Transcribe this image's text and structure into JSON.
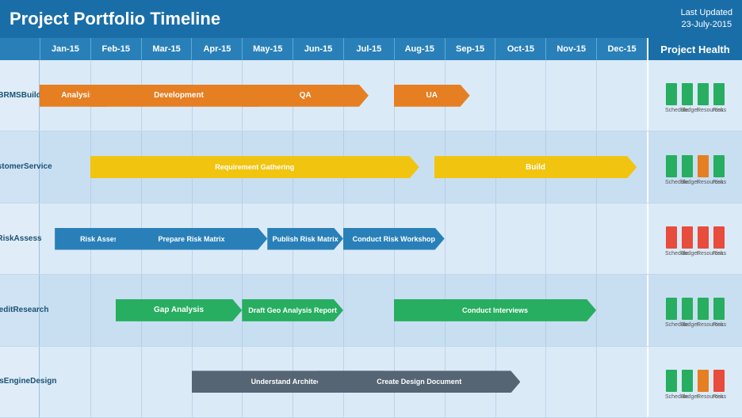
{
  "header": {
    "title": "Project Portfolio Timeline",
    "last_updated_label": "Last Updated",
    "last_updated_date": "23-July-2015"
  },
  "months": [
    "Jan-15",
    "Feb-15",
    "Mar-15",
    "Apr-15",
    "May-15",
    "Jun-15",
    "Jul-15",
    "Aug-15",
    "Sep-15",
    "Oct-15",
    "Nov-15",
    "Dec-15"
  ],
  "project_health_label": "Project Health",
  "projects": [
    {
      "label": "BRMS Build",
      "tasks": [
        {
          "label": "Analysis",
          "color": "#e67e22",
          "start": 0,
          "end": 1.5
        },
        {
          "label": "Development",
          "color": "#e67e22",
          "start": 1,
          "end": 4.5
        },
        {
          "label": "QA",
          "color": "#e67e22",
          "start": 4,
          "end": 6.5
        },
        {
          "label": "UA",
          "color": "#e67e22",
          "start": 7,
          "end": 8.5
        }
      ],
      "health": [
        {
          "color": "green",
          "height": 28
        },
        {
          "color": "green",
          "height": 28
        },
        {
          "color": "green",
          "height": 28
        },
        {
          "color": "green",
          "height": 28
        }
      ]
    },
    {
      "label": "Customer Service",
      "tasks": [
        {
          "label": "Requirement Gathering",
          "color": "#f1c40f",
          "start": 1,
          "end": 7.5
        },
        {
          "label": "Build",
          "color": "#f1c40f",
          "start": 7.8,
          "end": 11.8
        }
      ],
      "health": [
        {
          "color": "green",
          "height": 28
        },
        {
          "color": "green",
          "height": 28
        },
        {
          "color": "orange",
          "height": 28
        },
        {
          "color": "green",
          "height": 28
        }
      ]
    },
    {
      "label": "Risk Assess",
      "tasks": [
        {
          "label": "Risk Assessment Plan",
          "color": "#2980b9",
          "start": 0.3,
          "end": 2.8
        },
        {
          "label": "Prepare Risk Matrix",
          "color": "#2980b9",
          "start": 1.5,
          "end": 4.5
        },
        {
          "label": "Publish Risk Matrix",
          "color": "#2980b9",
          "start": 4.5,
          "end": 6
        },
        {
          "label": "Conduct Risk Workshop",
          "color": "#2980b9",
          "start": 6,
          "end": 8
        }
      ],
      "health": [
        {
          "color": "red",
          "height": 28
        },
        {
          "color": "red",
          "height": 28
        },
        {
          "color": "red",
          "height": 28
        },
        {
          "color": "red",
          "height": 28
        }
      ]
    },
    {
      "label": "Credit Research",
      "tasks": [
        {
          "label": "Gap Analysis",
          "color": "#27ae60",
          "start": 1.5,
          "end": 4
        },
        {
          "label": "Draft Geo Analysis Report",
          "color": "#27ae60",
          "start": 4,
          "end": 6
        },
        {
          "label": "Conduct Interviews",
          "color": "#27ae60",
          "start": 7,
          "end": 11
        }
      ],
      "health": [
        {
          "color": "green",
          "height": 28
        },
        {
          "color": "green",
          "height": 28
        },
        {
          "color": "green",
          "height": 28
        },
        {
          "color": "green",
          "height": 28
        }
      ]
    },
    {
      "label": "Rules Engine Design",
      "tasks": [
        {
          "label": "Understand Architecture",
          "color": "#566573",
          "start": 3,
          "end": 7
        },
        {
          "label": "Create Design Document",
          "color": "#566573",
          "start": 5.5,
          "end": 9.5
        }
      ],
      "health": [
        {
          "color": "green",
          "height": 28
        },
        {
          "color": "green",
          "height": 28
        },
        {
          "color": "orange",
          "height": 28
        },
        {
          "color": "red",
          "height": 28
        }
      ]
    }
  ],
  "health_labels": [
    "Schedule",
    "Budget",
    "Resources",
    "Risks"
  ]
}
